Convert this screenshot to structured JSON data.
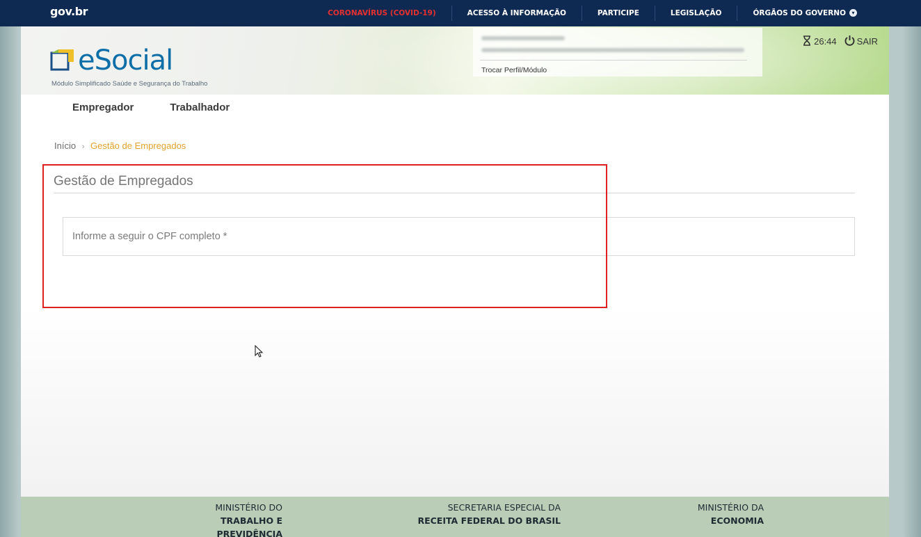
{
  "govbar": {
    "logo": "gov.br",
    "links": [
      {
        "label": "CORONAVÍRUS (COVID-19)",
        "highlight": true
      },
      {
        "label": "ACESSO À INFORMAÇÃO"
      },
      {
        "label": "PARTICIPE"
      },
      {
        "label": "LEGISLAÇÃO"
      },
      {
        "label": "ÓRGÃOS DO GOVERNO"
      }
    ]
  },
  "header": {
    "logo_text": "eSocial",
    "subtitle": "Módulo Simplificado Saúde e Segurança do Trabalho",
    "profile": {
      "switch_label": "Trocar Perfil/Módulo"
    },
    "timer": "26:44",
    "logout_label": "SAIR"
  },
  "nav": {
    "items": [
      "Empregador",
      "Trabalhador"
    ]
  },
  "breadcrumb": {
    "home": "Início",
    "separator": "›",
    "current": "Gestão de Empregados"
  },
  "main": {
    "title": "Gestão de Empregados",
    "cpf_label": "Informe a seguir o CPF completo *"
  },
  "footer": {
    "blocks": [
      {
        "line1": "MINISTÉRIO DO",
        "line2": "TRABALHO E PREVIDÊNCIA"
      },
      {
        "line1": "SECRETARIA ESPECIAL DA",
        "line2": "RECEITA FEDERAL DO BRASIL"
      },
      {
        "line1": "MINISTÉRIO DA",
        "line2": "ECONOMIA"
      }
    ]
  },
  "colors": {
    "govbar_bg": "#0f2a52",
    "covid_link": "#e53030",
    "brand_blue": "#0e6fa8",
    "breadcrumb_current": "#e2a12c",
    "highlight_border": "#e02020",
    "footer_bg": "#b9cdb7"
  }
}
